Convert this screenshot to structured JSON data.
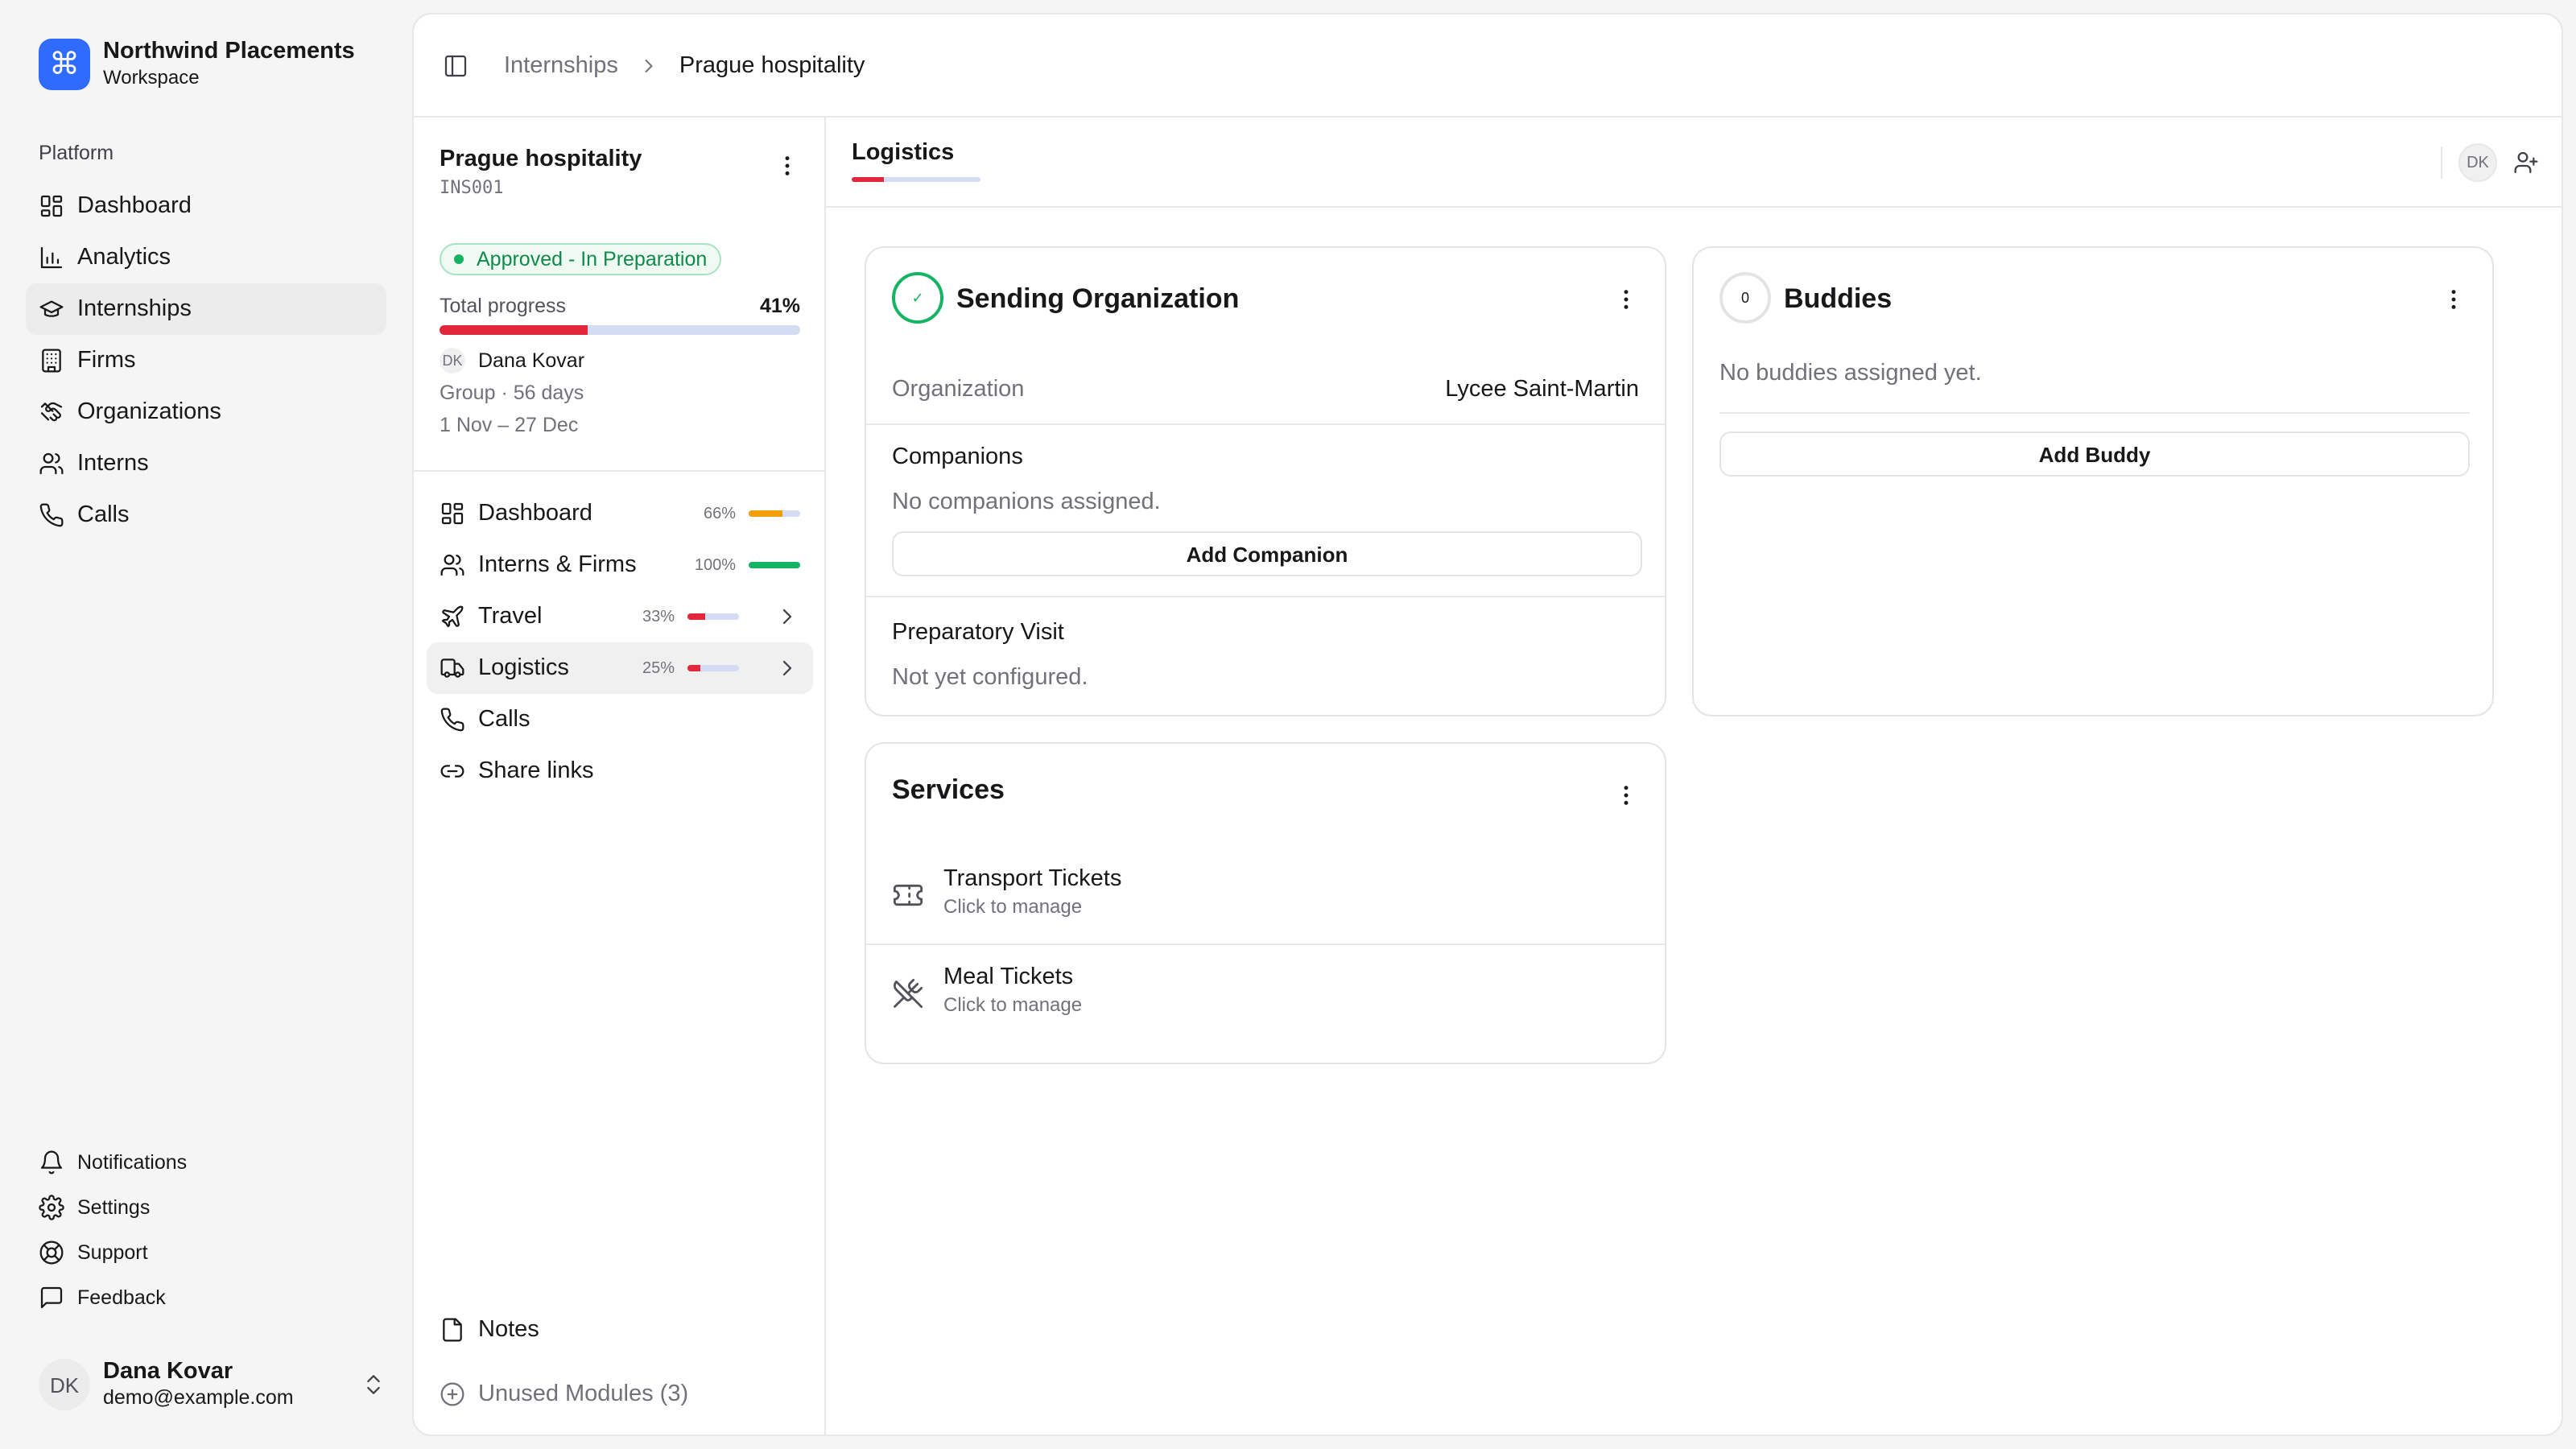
{
  "workspace": {
    "name": "Northwind Placements",
    "subtitle": "Workspace",
    "logo_glyph": "⌘",
    "accent": "#2f6bff"
  },
  "sidebar": {
    "section_label": "Platform",
    "items": [
      {
        "label": "Dashboard",
        "icon": "grid-icon"
      },
      {
        "label": "Analytics",
        "icon": "bar-chart-icon"
      },
      {
        "label": "Internships",
        "icon": "graduation-cap-icon",
        "active": true
      },
      {
        "label": "Firms",
        "icon": "building-icon"
      },
      {
        "label": "Organizations",
        "icon": "handshake-icon"
      },
      {
        "label": "Interns",
        "icon": "users-icon"
      },
      {
        "label": "Calls",
        "icon": "phone-icon"
      }
    ],
    "bottom_items": [
      {
        "label": "Notifications",
        "icon": "bell-icon"
      },
      {
        "label": "Settings",
        "icon": "gear-icon"
      },
      {
        "label": "Support",
        "icon": "lifebuoy-icon"
      },
      {
        "label": "Feedback",
        "icon": "message-square-icon"
      }
    ]
  },
  "user": {
    "initials": "DK",
    "name": "Dana Kovar",
    "email": "demo@example.com"
  },
  "breadcrumb": {
    "parent": "Internships",
    "current": "Prague hospitality"
  },
  "internship": {
    "title": "Prague hospitality",
    "code": "INS001",
    "status": "Approved - In Preparation",
    "status_color": "#16b364",
    "progress_label": "Total progress",
    "progress_value": "41%",
    "progress_fraction": 0.41,
    "owner_initials": "DK",
    "owner_name": "Dana Kovar",
    "type": "Group",
    "duration": "56 days",
    "dates": "1 Nov – 27 Dec"
  },
  "modules": [
    {
      "label": "Dashboard",
      "icon": "grid-icon",
      "pct": "66%",
      "fraction": 0.66,
      "color": "#f59e0b",
      "chevron": false
    },
    {
      "label": "Interns & Firms",
      "icon": "users-icon",
      "pct": "100%",
      "fraction": 1.0,
      "color": "#16b364",
      "chevron": false
    },
    {
      "label": "Travel",
      "icon": "plane-icon",
      "pct": "33%",
      "fraction": 0.33,
      "color": "#e2273b",
      "chevron": true
    },
    {
      "label": "Logistics",
      "icon": "truck-icon",
      "pct": "25%",
      "fraction": 0.25,
      "color": "#e2273b",
      "chevron": true,
      "active": true
    },
    {
      "label": "Calls",
      "icon": "phone-icon"
    },
    {
      "label": "Share links",
      "icon": "link-icon"
    }
  ],
  "notes_label": "Notes",
  "unused_label": "Unused Modules (3)",
  "tab": {
    "title": "Logistics",
    "fraction": 0.25,
    "avatar": "DK"
  },
  "sending_org": {
    "title": "Sending Organization",
    "org_label": "Organization",
    "org_value": "Lycee Saint-Martin",
    "companions_label": "Companions",
    "companions_empty": "No companions assigned.",
    "add_companion": "Add Companion",
    "prep_label": "Preparatory Visit",
    "prep_value": "Not yet configured."
  },
  "buddies": {
    "title": "Buddies",
    "count": "0",
    "empty": "No buddies assigned yet.",
    "add_button": "Add Buddy"
  },
  "services": {
    "title": "Services",
    "items": [
      {
        "title": "Transport Tickets",
        "sub": "Click to manage",
        "icon": "ticket-icon"
      },
      {
        "title": "Meal Tickets",
        "sub": "Click to manage",
        "icon": "utensils-crossed-icon"
      }
    ]
  }
}
